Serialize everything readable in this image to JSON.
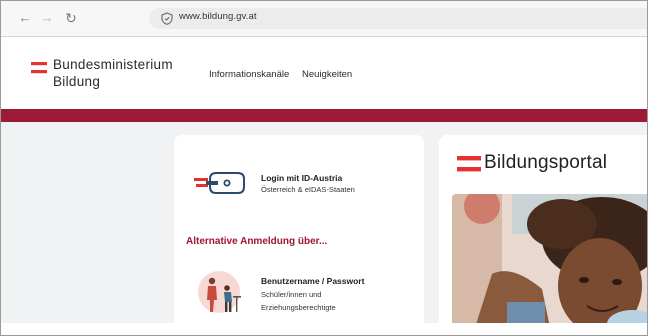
{
  "browser": {
    "url": "www.bildung.gv.at",
    "icons": [
      "back-arrow-icon",
      "forward-arrow-icon",
      "reload-icon",
      "shield-icon"
    ]
  },
  "header": {
    "ministry_line1": "Bundesministerium",
    "ministry_line2": "Bildung",
    "nav": [
      {
        "label": "Informationskanäle"
      },
      {
        "label": "Neuigkeiten"
      }
    ],
    "band_color": "#9c1a35"
  },
  "login": {
    "id_austria_title": "Login mit ID-Austria",
    "id_austria_subtitle": "Österreich & eIDAS-Staaten",
    "alternative_heading": "Alternative Anmeldung über...",
    "userpass_title": "Benutzername / Passwort",
    "userpass_sub_line1": "Schüler/innen und",
    "userpass_sub_line2": "Erziehungsberechtigte"
  },
  "portal": {
    "title": "Bildungsportal"
  },
  "colors": {
    "accent_red": "#e6322e",
    "heading_red": "#a0162f",
    "page_bg": "#f1f2f4"
  }
}
